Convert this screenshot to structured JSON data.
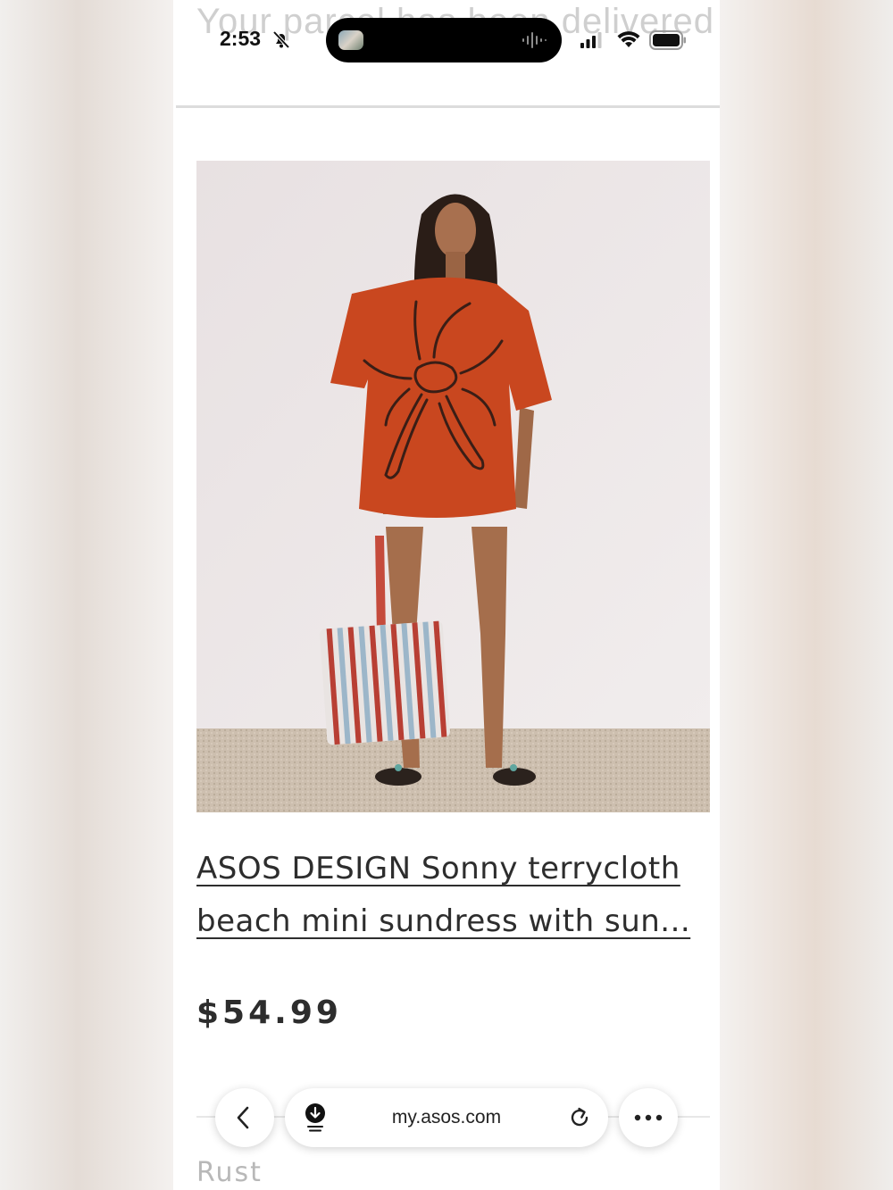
{
  "status_bar": {
    "time": "2:53",
    "background_text": "Your parcel has been delivered"
  },
  "product": {
    "image_alt": "Model wearing rust terrycloth mini sundress with sun embroidery holding a striped tote bag",
    "title": "ASOS DESIGN Sonny terrycloth beach mini sundress with sun...",
    "price": "$54.99",
    "colour": "Rust"
  },
  "browser": {
    "url": "my.asos.com",
    "icons": [
      "chevron-left-icon",
      "download-icon",
      "reload-icon",
      "more-icon"
    ]
  },
  "colors": {
    "dress": "#c9471f",
    "text": "#2d2d2d",
    "page_bg": "#ffffff"
  }
}
